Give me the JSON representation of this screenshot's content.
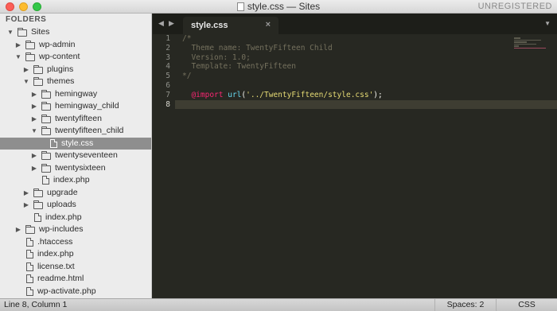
{
  "window": {
    "title": "style.css — Sites",
    "license": "UNREGISTERED"
  },
  "sidebar": {
    "header": "FOLDERS",
    "tree": [
      {
        "label": "Sites",
        "kind": "folder",
        "expanded": true,
        "depth": 0
      },
      {
        "label": "wp-admin",
        "kind": "folder",
        "expanded": false,
        "depth": 1
      },
      {
        "label": "wp-content",
        "kind": "folder",
        "expanded": true,
        "depth": 1
      },
      {
        "label": "plugins",
        "kind": "folder",
        "expanded": false,
        "depth": 2
      },
      {
        "label": "themes",
        "kind": "folder",
        "expanded": true,
        "depth": 2
      },
      {
        "label": "hemingway",
        "kind": "folder",
        "expanded": false,
        "depth": 3
      },
      {
        "label": "hemingway_child",
        "kind": "folder",
        "expanded": false,
        "depth": 3
      },
      {
        "label": "twentyfifteen",
        "kind": "folder",
        "expanded": false,
        "depth": 3
      },
      {
        "label": "twentyfifteen_child",
        "kind": "folder",
        "expanded": true,
        "depth": 3
      },
      {
        "label": "style.css",
        "kind": "file",
        "depth": 4,
        "selected": true
      },
      {
        "label": "twentyseventeen",
        "kind": "folder",
        "expanded": false,
        "depth": 3
      },
      {
        "label": "twentysixteen",
        "kind": "folder",
        "expanded": false,
        "depth": 3
      },
      {
        "label": "index.php",
        "kind": "file",
        "depth": 3
      },
      {
        "label": "upgrade",
        "kind": "folder",
        "expanded": false,
        "depth": 2
      },
      {
        "label": "uploads",
        "kind": "folder",
        "expanded": false,
        "depth": 2
      },
      {
        "label": "index.php",
        "kind": "file",
        "depth": 2
      },
      {
        "label": "wp-includes",
        "kind": "folder",
        "expanded": false,
        "depth": 1
      },
      {
        "label": ".htaccess",
        "kind": "file",
        "depth": 1
      },
      {
        "label": "index.php",
        "kind": "file",
        "depth": 1
      },
      {
        "label": "license.txt",
        "kind": "file",
        "depth": 1
      },
      {
        "label": "readme.html",
        "kind": "file",
        "depth": 1
      },
      {
        "label": "wp-activate.php",
        "kind": "file",
        "depth": 1
      }
    ]
  },
  "tabs": [
    {
      "label": "style.css",
      "close": "×",
      "active": true
    }
  ],
  "editor": {
    "line_numbers": [
      "1",
      "2",
      "3",
      "4",
      "5",
      "6",
      "7",
      "8"
    ],
    "current_line": 8,
    "lines": [
      {
        "tokens": [
          {
            "t": "/*",
            "c": "comment"
          }
        ]
      },
      {
        "tokens": [
          {
            "t": "  Theme name: TwentyFifteen Child",
            "c": "comment"
          }
        ]
      },
      {
        "tokens": [
          {
            "t": "  Version: 1.0;",
            "c": "comment"
          }
        ]
      },
      {
        "tokens": [
          {
            "t": "  Template: TwentyFifteen",
            "c": "comment"
          }
        ]
      },
      {
        "tokens": [
          {
            "t": "*/",
            "c": "comment"
          }
        ]
      },
      {
        "tokens": []
      },
      {
        "tokens": [
          {
            "t": "  ",
            "c": "plain"
          },
          {
            "t": "@import",
            "c": "at"
          },
          {
            "t": " ",
            "c": "plain"
          },
          {
            "t": "url",
            "c": "fn"
          },
          {
            "t": "(",
            "c": "punct"
          },
          {
            "t": "'../TwentyFifteen/style.css'",
            "c": "str"
          },
          {
            "t": ");",
            "c": "punct"
          }
        ]
      },
      {
        "tokens": []
      }
    ]
  },
  "statusbar": {
    "position": "Line 8, Column 1",
    "indentation": "Spaces: 2",
    "syntax": "CSS"
  },
  "colors": {
    "editor_bg": "#272822",
    "comment": "#75715e",
    "keyword": "#f92672",
    "function": "#66d9ef",
    "string": "#e6db74"
  }
}
